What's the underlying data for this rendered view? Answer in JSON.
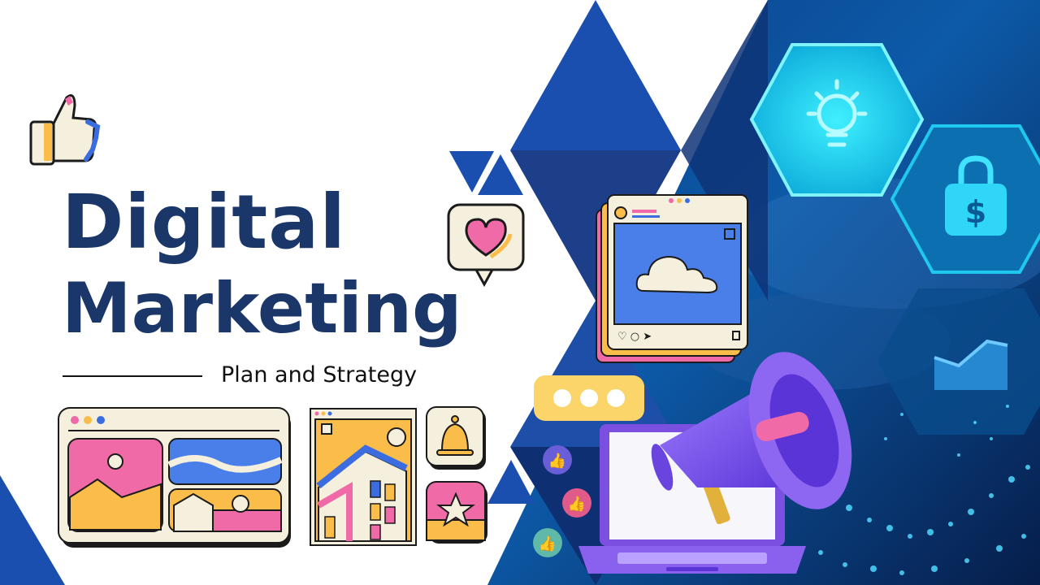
{
  "slide": {
    "title_line1": "Digital",
    "title_line2": "Marketing",
    "subtitle": "Plan and Strategy"
  },
  "colors": {
    "navy": "#1b3668",
    "royal_blue": "#1a4fb0",
    "pink": "#f06aa8",
    "yellow": "#fbbd4a",
    "cream": "#f5efde",
    "cyan_glow": "#1fd6f0",
    "purple": "#7b4fe0"
  },
  "icons": [
    "thumbs-up-icon",
    "heart-bubble-icon",
    "lightbulb-icon",
    "dollar-lock-icon",
    "bar-chart-icon",
    "cloud-icon",
    "bell-icon",
    "star-icon",
    "megaphone-icon",
    "laptop-icon",
    "typing-dots-icon"
  ]
}
